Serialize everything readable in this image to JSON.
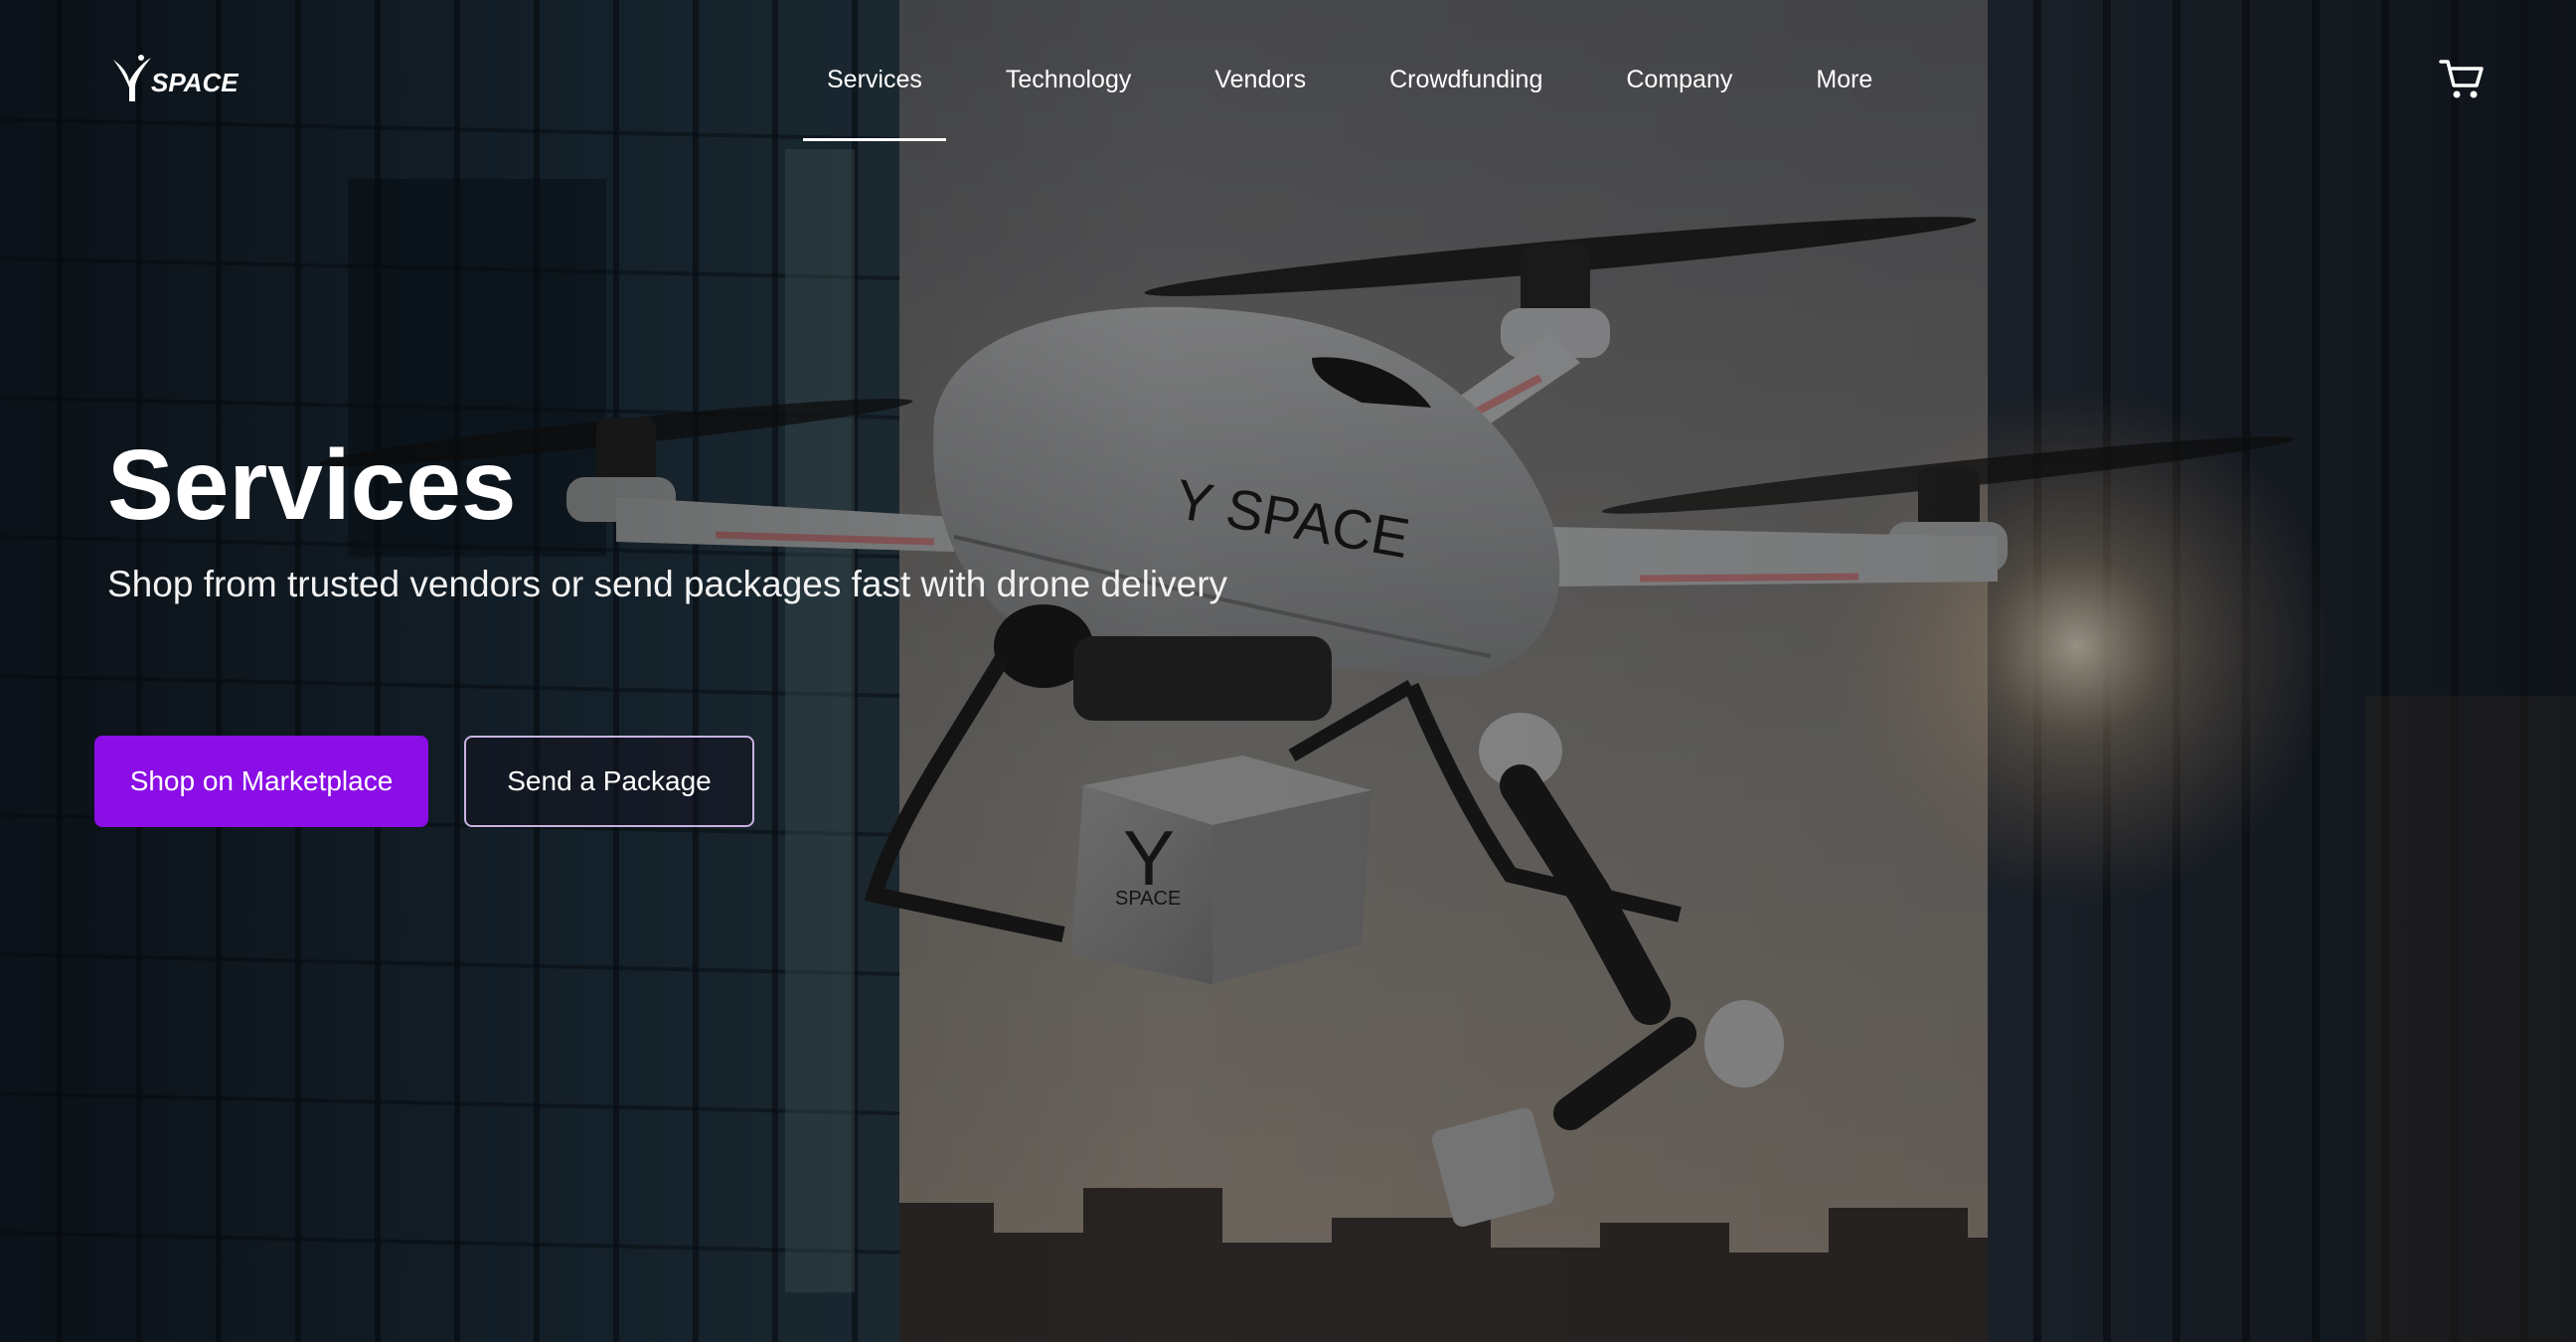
{
  "brand": {
    "logo_text": "SPACE",
    "accent_color": "#8b0ee6"
  },
  "nav": {
    "items": [
      {
        "label": "Services",
        "active": true
      },
      {
        "label": "Technology",
        "active": false
      },
      {
        "label": "Vendors",
        "active": false
      },
      {
        "label": "Crowdfunding",
        "active": false
      },
      {
        "label": "Company",
        "active": false
      },
      {
        "label": "More",
        "active": false
      }
    ],
    "cart_icon": "cart-icon"
  },
  "hero": {
    "title": "Services",
    "subtitle": "Shop from trusted vendors or send packages fast with drone delivery",
    "primary_cta": "Shop on Marketplace",
    "secondary_cta": "Send a Package",
    "drone_branding": "Y SPACE",
    "package_branding_letter": "Y",
    "package_branding_text": "SPACE"
  }
}
